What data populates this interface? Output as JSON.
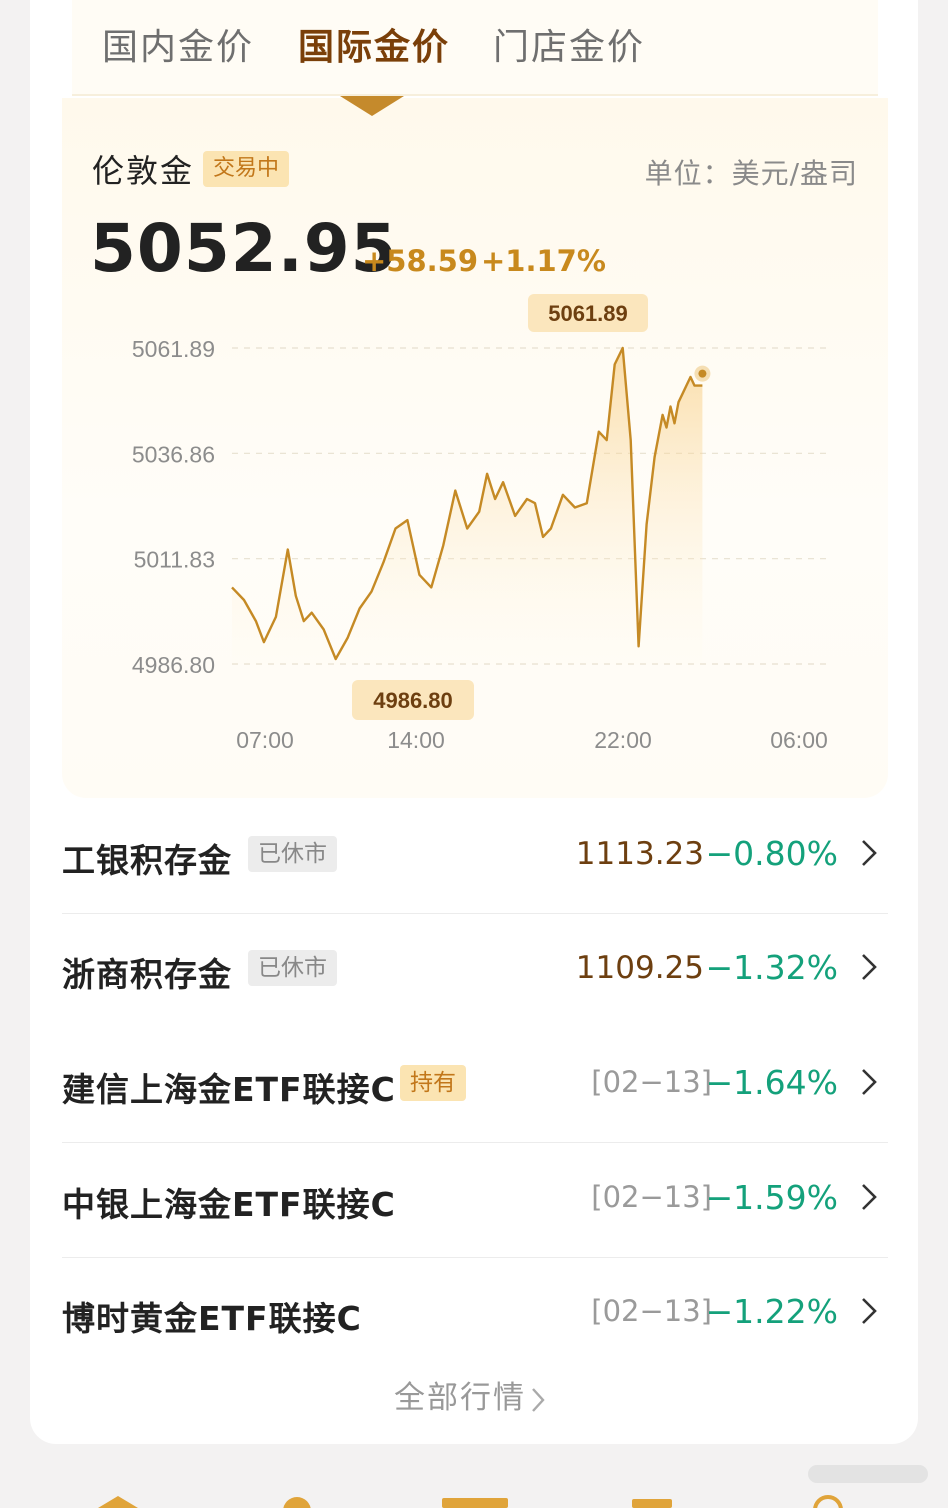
{
  "tabs": [
    {
      "label": "国内金价",
      "active": false
    },
    {
      "label": "国际金价",
      "active": true
    },
    {
      "label": "门店金价",
      "active": false
    }
  ],
  "quote": {
    "name": "伦敦金",
    "status_badge": "交易中",
    "unit": "单位：美元/盎司",
    "price": "5052.95",
    "change": "+58.59",
    "change_pct": "+1.17%"
  },
  "chart_data": {
    "type": "area",
    "y_ticks": [
      "5061.89",
      "5036.86",
      "5011.83",
      "4986.80"
    ],
    "x_ticks": [
      "07:00",
      "14:00",
      "22:00",
      "06:00"
    ],
    "ylim": [
      4986.8,
      5061.89
    ],
    "high_label": "5061.89",
    "low_label": "4986.80",
    "grid": true,
    "series": [
      {
        "x": [
          "05:40",
          "06:10",
          "06:40",
          "07:00",
          "07:30",
          "08:00",
          "08:20",
          "08:40",
          "09:00",
          "09:30",
          "10:00",
          "10:30",
          "11:00",
          "11:30",
          "12:00",
          "12:30",
          "13:00",
          "13:30",
          "14:00",
          "14:30",
          "15:00",
          "15:30",
          "16:00",
          "16:20",
          "16:40",
          "17:00",
          "17:30",
          "18:00",
          "18:20",
          "18:40",
          "19:00",
          "19:30",
          "20:00",
          "20:30",
          "21:00",
          "21:20",
          "21:40",
          "22:00",
          "22:20",
          "22:40",
          "23:00",
          "23:20",
          "23:40",
          "23:50",
          "00:00",
          "00:10",
          "00:20",
          "00:30",
          "00:40",
          "00:50",
          "01:00",
          "01:20"
        ],
        "values": [
          5005,
          5002,
          4997,
          4992,
          4998,
          5014,
          5003,
          4997,
          4999,
          4995,
          4988,
          4993,
          5000,
          5004,
          5011,
          5019,
          5021,
          5008,
          5005,
          5015,
          5028,
          5019,
          5023,
          5032,
          5026,
          5030,
          5022,
          5026,
          5025,
          5017,
          5019,
          5027,
          5024,
          5025,
          5042,
          5040,
          5058,
          5061.89,
          5040,
          4991,
          5020,
          5036,
          5046,
          5043,
          5048,
          5044,
          5049,
          5051,
          5053,
          5055,
          5052.95,
          5052.95
        ]
      }
    ]
  },
  "list": [
    {
      "name": "工银积存金",
      "badge": "已休市",
      "badge_type": "closed",
      "value": "1113.23",
      "pct": "−0.80%"
    },
    {
      "name": "浙商积存金",
      "badge": "已休市",
      "badge_type": "closed",
      "value": "1109.25",
      "pct": "−1.32%"
    },
    {
      "name": "建信上海金ETF联接C",
      "badge": "持有",
      "badge_type": "hold",
      "date": "[02−13]",
      "pct": "−1.64%"
    },
    {
      "name": "中银上海金ETF联接C",
      "date": "[02−13]",
      "pct": "−1.59%"
    },
    {
      "name": "博时黄金ETF联接C",
      "date": "[02−13]",
      "pct": "−1.22%"
    }
  ],
  "all_link": "全部行情",
  "colors": {
    "accent": "#c8891d",
    "down": "#14a17b",
    "active_tab": "#7a3f09"
  }
}
